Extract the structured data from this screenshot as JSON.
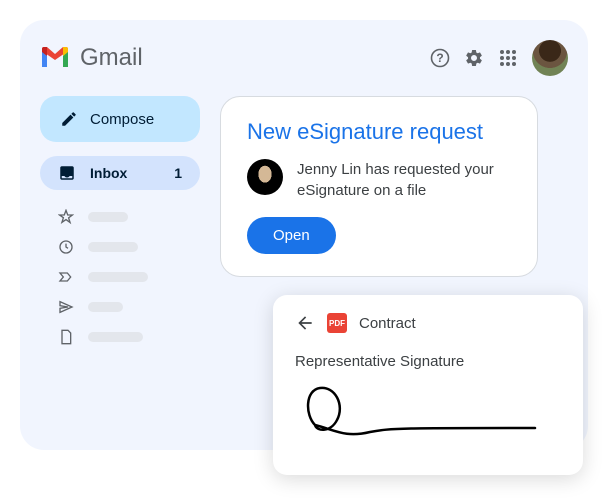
{
  "app": {
    "title": "Gmail"
  },
  "icons": {
    "help": "help-icon",
    "settings": "gear-icon",
    "apps": "apps-grid-icon"
  },
  "sidebar": {
    "compose": "Compose",
    "inbox": {
      "label": "Inbox",
      "count": "1"
    }
  },
  "card": {
    "title": "New eSignature request",
    "message": "Jenny Lin has requested your eSignature on a file",
    "button": "Open"
  },
  "signature": {
    "filetype": "PDF",
    "filename": "Contract",
    "field_label": "Representative Signature"
  }
}
